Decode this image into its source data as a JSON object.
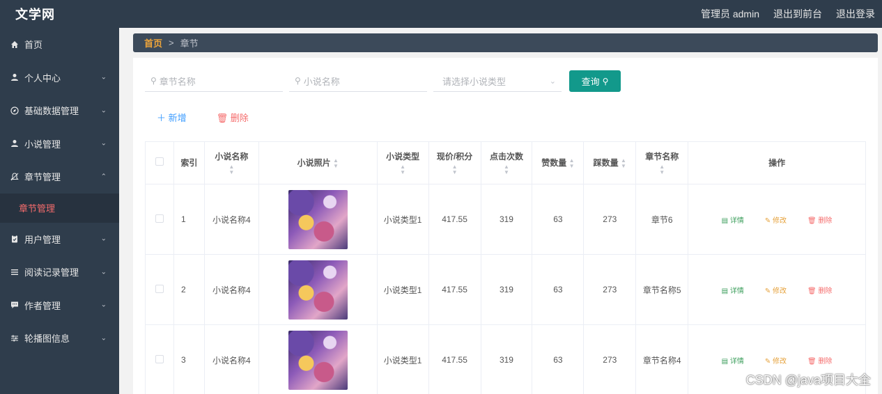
{
  "header": {
    "logo": "文学网",
    "admin_label": "管理员 admin",
    "to_front": "退出到前台",
    "logout": "退出登录"
  },
  "sidebar": {
    "items": [
      {
        "label": "首页",
        "icon": "home-icon"
      },
      {
        "label": "个人中心",
        "icon": "user-icon"
      },
      {
        "label": "基础数据管理",
        "icon": "compass-icon"
      },
      {
        "label": "小说管理",
        "icon": "user-icon"
      },
      {
        "label": "章节管理",
        "icon": "bell-icon"
      },
      {
        "label": "用户管理",
        "icon": "clipboard-icon"
      },
      {
        "label": "阅读记录管理",
        "icon": "list-icon"
      },
      {
        "label": "作者管理",
        "icon": "chat-icon"
      },
      {
        "label": "轮播图信息",
        "icon": "sliders-icon"
      }
    ],
    "active_sub": "章节管理"
  },
  "breadcrumb": {
    "home": "首页",
    "separator": ">",
    "current": "章节"
  },
  "search": {
    "chapter_placeholder": "章节名称",
    "novel_placeholder": "小说名称",
    "type_placeholder": "请选择小说类型",
    "query_button": "查询"
  },
  "actions": {
    "add": "新增",
    "delete": "删除"
  },
  "table": {
    "headers": {
      "index": "索引",
      "novel_name": "小说名称",
      "novel_photo": "小说照片",
      "novel_type": "小说类型",
      "price": "现价/积分",
      "clicks": "点击次数",
      "likes": "赞数量",
      "dislikes": "踩数量",
      "chapter_name": "章节名称",
      "operations": "操作"
    },
    "ops": {
      "detail": "详情",
      "edit": "修改",
      "delete": "删除"
    },
    "rows": [
      {
        "index": "1",
        "novel_name": "小说名称4",
        "novel_type": "小说类型1",
        "price": "417.55",
        "clicks": "319",
        "likes": "63",
        "dislikes": "273",
        "chapter_name": "章节6"
      },
      {
        "index": "2",
        "novel_name": "小说名称4",
        "novel_type": "小说类型1",
        "price": "417.55",
        "clicks": "319",
        "likes": "63",
        "dislikes": "273",
        "chapter_name": "章节名称5"
      },
      {
        "index": "3",
        "novel_name": "小说名称4",
        "novel_type": "小说类型1",
        "price": "417.55",
        "clicks": "319",
        "likes": "63",
        "dislikes": "273",
        "chapter_name": "章节名称4"
      }
    ]
  },
  "watermark": "CSDN @java项目大全",
  "colors": {
    "sidebar_bg": "#2f3d4c",
    "query_button": "#12998b",
    "active_sub": "#f56c6c",
    "breadcrumb_home": "#f0a63a"
  }
}
